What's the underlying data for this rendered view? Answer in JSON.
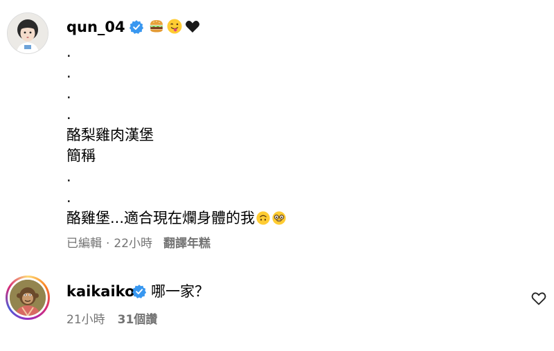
{
  "caption": {
    "username": "qun_04",
    "verified": true,
    "name_emojis": [
      "hamburger-emoji",
      "tongue-face-emoji",
      "black-heart-emoji"
    ],
    "lines": [
      ".",
      ".",
      ".",
      ".",
      "酪梨雞肉漢堡",
      "簡稱",
      ".",
      ".",
      "酪雞堡...適合現在爛身體的我"
    ],
    "last_line_emojis": [
      "upside-down-face-emoji",
      "nerd-face-emoji"
    ],
    "meta": {
      "edited": "已編輯",
      "separator": "·",
      "time": "22小時",
      "see_translation": "翻譯年糕"
    }
  },
  "reply": {
    "username": "kaikaiko",
    "verified": true,
    "text": "哪一家？",
    "meta": {
      "time": "21小時",
      "likes": "31個讚"
    },
    "like_icon": "heart-outline-icon"
  },
  "colors": {
    "verified_blue": "#3897f0",
    "meta_gray": "#737373",
    "text": "#000000"
  }
}
